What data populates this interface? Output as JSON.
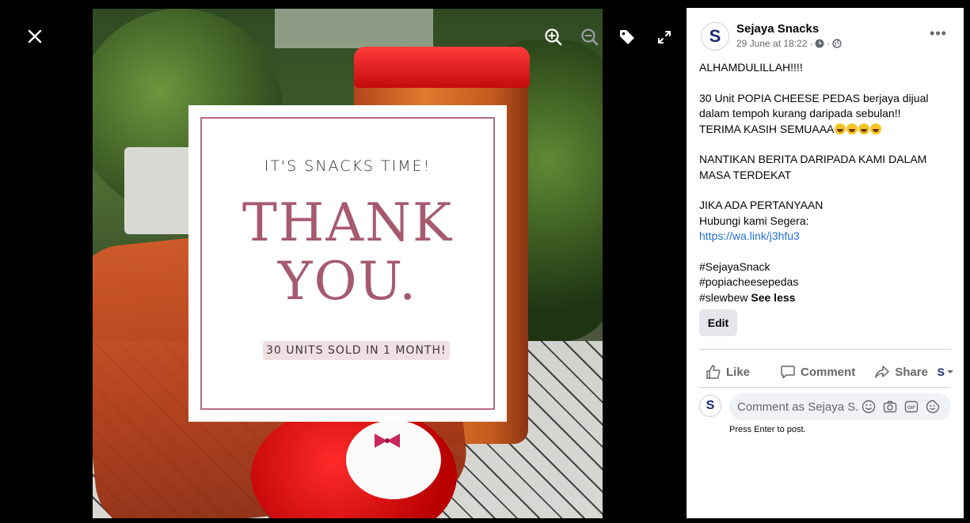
{
  "viewer": {
    "close_label": "Close",
    "card": {
      "kicker": "IT'S SNACKS TIME!",
      "headline_line1": "THANK",
      "headline_line2": "YOU.",
      "badge": "30 UNITS SOLD IN 1 MONTH!"
    },
    "toolbar": {
      "icons": [
        "zoom-in-icon",
        "zoom-out-icon",
        "tag-icon",
        "fullscreen-icon"
      ]
    }
  },
  "post": {
    "page_name": "Sejaya Snacks",
    "avatar_letter": "S",
    "timestamp": "29 June at 18:22",
    "separator": "·",
    "more_label": "•••",
    "text": {
      "line1": "ALHAMDULILLAH!!!!",
      "para2_line1": "30 Unit POPIA CHEESE PEDAS berjaya dijual",
      "para2_line2": "dalam tempoh kurang daripada sebulan!!",
      "para2_line3": "TERIMA KASIH SEMUAAA",
      "para3_line1": "NANTIKAN BERITA DARIPADA KAMI DALAM",
      "para3_line2": "MASA TERDEKAT",
      "para4_line1": "JIKA ADA PERTANYAAN",
      "para4_line2": "Hubungi kami Segera:",
      "link": "https://wa.link/j3hfu3",
      "hashtag1": "#SejayaSnack",
      "hashtag2": "#popiacheesepedas",
      "hashtag3": "#slewbew",
      "see_less": "See less"
    },
    "edit_label": "Edit"
  },
  "actions": {
    "like": "Like",
    "comment": "Comment",
    "share": "Share",
    "actor_letter": "S"
  },
  "composer": {
    "placeholder": "Comment as Sejaya S...",
    "hint": "Press Enter to post.",
    "avatar_letter": "S"
  },
  "colors": {
    "accent_link": "#216fdb",
    "card_text": "#a65a6e",
    "card_frame": "#b76b7d",
    "brand_navy": "#1b2b70"
  }
}
